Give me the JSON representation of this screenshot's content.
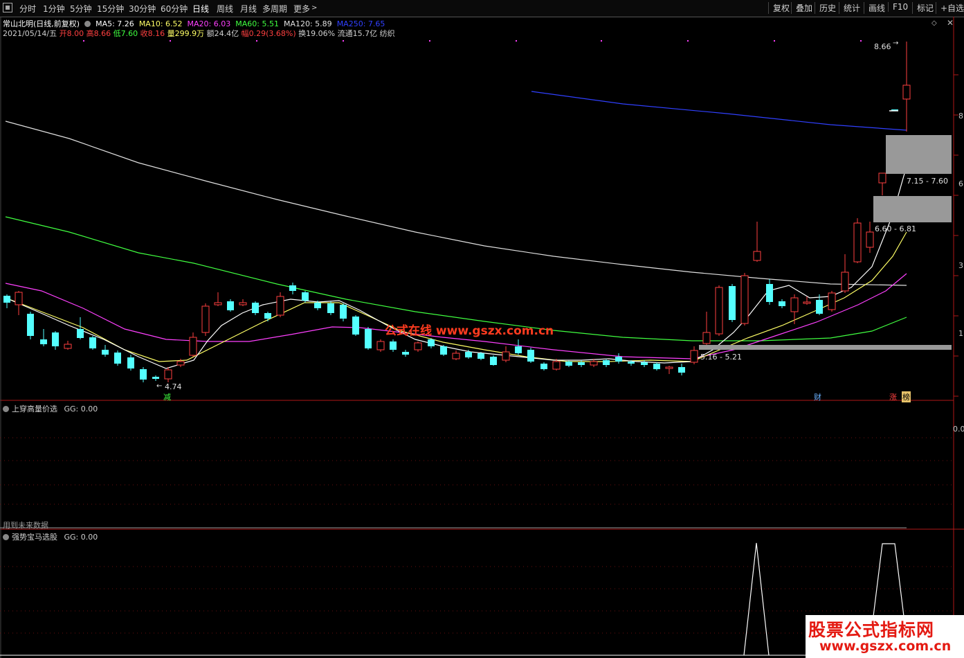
{
  "toolbar": {
    "periods": [
      "分时",
      "1分钟",
      "5分钟",
      "15分钟",
      "30分钟",
      "60分钟",
      "日线",
      "周线",
      "月线",
      "多周期",
      "更多"
    ],
    "active_period": "日线",
    "right_buttons": [
      "复权",
      "叠加",
      "历史",
      "统计",
      "画线",
      "F10",
      "标记",
      "+自选"
    ]
  },
  "header": {
    "stock_name": "常山北明(日线,前复权)",
    "ma": [
      {
        "label": "MA5: 7.26",
        "color": "#ffffff"
      },
      {
        "label": "MA10: 6.52",
        "color": "#ffff66"
      },
      {
        "label": "MA20: 6.03",
        "color": "#ff40ff"
      },
      {
        "label": "MA60: 5.51",
        "color": "#40ff40"
      },
      {
        "label": "MA120: 5.89",
        "color": "#e0e0e0"
      },
      {
        "label": "MA250: 7.65",
        "color": "#3040ff"
      }
    ],
    "date": "2021/05/14/五",
    "open_label": "开",
    "open": "8.00",
    "high_label": "高",
    "high": "8.66",
    "low_label": "低",
    "low": "7.60",
    "close_label": "收",
    "close": "8.16",
    "vol_label": "量",
    "vol": "299.9万",
    "amount": "额24.4亿",
    "amp_label": "幅",
    "amp": "0.29(3.68%)",
    "turnover": "换19.06%",
    "float": "流通15.7亿",
    "industry": "纺织"
  },
  "annotations": {
    "high_price": "8.66",
    "low_price": "4.74",
    "zone1": "7.15 - 7.60",
    "zone2": "6.60 - 6.81",
    "zone3": "5.16 - 5.21",
    "marker_jian": "减",
    "marker_cai": "财",
    "marker_zhang": "涨",
    "marker_bang": "榜",
    "watermark": "公式在线 www.gszx.com.cn"
  },
  "axis": {
    "price_ticks": [
      "8",
      "6",
      "3",
      "1"
    ],
    "panel2_tick": "0.0"
  },
  "panel2": {
    "title": "上穿高量价选",
    "value": "GG: 0.00",
    "note": "用到未来数据"
  },
  "panel3": {
    "title": "强势宝马选股",
    "value": "GG: 0.00"
  },
  "brand": {
    "title": "股票公式指标网",
    "url": "www.gszx.com.cn"
  },
  "colors": {
    "up": "#ff4040",
    "down": "#54ffff",
    "ma5": "#ffffff",
    "ma10": "#ffff66",
    "ma20": "#ff40ff",
    "ma60": "#40ff40",
    "ma120": "#e0e0e0",
    "ma250": "#3040ff"
  }
}
